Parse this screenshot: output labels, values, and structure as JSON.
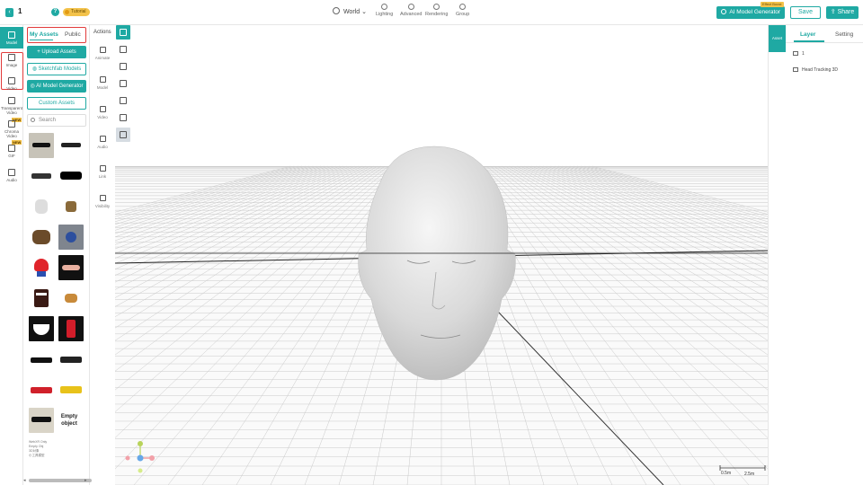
{
  "header": {
    "project_name": "1",
    "tutorial_label": "Tutorial",
    "world_label": "World",
    "tools": [
      {
        "label": "Lighting",
        "icon": "lighting-icon"
      },
      {
        "label": "Advanced",
        "icon": "advanced-icon"
      },
      {
        "label": "Rendering",
        "icon": "rendering-icon"
      },
      {
        "label": "Group",
        "icon": "group-icon"
      }
    ],
    "ai_button": "AI Model Generator",
    "effect_badge": "Effect Boost",
    "save": "Save",
    "share": "Share"
  },
  "rail": {
    "items": [
      {
        "label": "Model",
        "icon": "cube-icon"
      },
      {
        "label": "Image",
        "icon": "image-icon"
      },
      {
        "label": "Video",
        "icon": "film-icon"
      },
      {
        "label": "Transparent Video",
        "icon": "transparent-video-icon"
      },
      {
        "label": "Chroma Video",
        "icon": "chroma-video-icon"
      },
      {
        "label": "GIF",
        "icon": "gif-icon"
      },
      {
        "label": "Audio",
        "icon": "music-icon"
      }
    ],
    "new_badge": "NEW"
  },
  "assets": {
    "tab_my": "My Assets",
    "tab_public": "Public",
    "upload": "Upload Assets",
    "sketchfab": "Sketchfab Models",
    "ai_gen": "AI Model Generator",
    "custom": "Custom Assets",
    "search_placeholder": "Search",
    "empty_object": "Empty object",
    "tiny_caption": "WebXR Only\nEmpty Obj\n3D对象\n小工具模型"
  },
  "actions": {
    "title": "Actions",
    "items": [
      {
        "label": "Animate",
        "icon": "animate-icon"
      },
      {
        "label": "Model",
        "icon": "model-icon"
      },
      {
        "label": "Video",
        "icon": "video-icon"
      },
      {
        "label": "Audio",
        "icon": "audio-icon"
      },
      {
        "label": "Link",
        "icon": "link-icon"
      },
      {
        "label": "Visibility",
        "icon": "visibility-icon"
      }
    ]
  },
  "viewport": {
    "scale_a": "0.5m",
    "scale_b": "2.5m"
  },
  "right_panel": {
    "asset_tab": "Asset",
    "tab_layer": "Layer",
    "tab_setting": "Setting",
    "layers": [
      {
        "label": "1",
        "icon": "layer-icon"
      },
      {
        "label": "Head Tracking 3D",
        "icon": "head-tracking-icon"
      }
    ]
  },
  "colors": {
    "accent": "#1fa9a3",
    "highlight": "#e23b3b",
    "badge": "#f3c24a"
  }
}
